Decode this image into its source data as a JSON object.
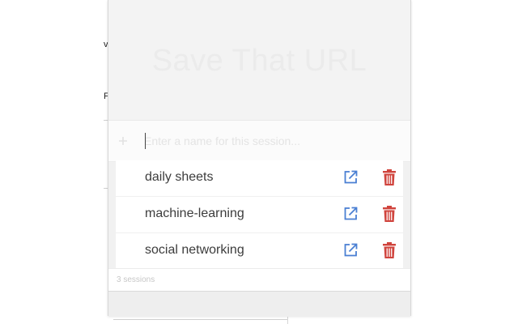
{
  "background": {
    "fragment_top": "v",
    "fragment_mid": "F"
  },
  "app": {
    "title": "Save That URL"
  },
  "input": {
    "value": "",
    "placeholder": "Enter a name for this session..."
  },
  "sessions": [
    {
      "name": "daily sheets"
    },
    {
      "name": "machine-learning"
    },
    {
      "name": "social networking"
    }
  ],
  "footer": {
    "count_text": "3 sessions"
  },
  "colors": {
    "open_icon": "#4a7fd3",
    "delete_icon": "#d0443d"
  },
  "icons": {
    "input": "plus-icon",
    "open": "external-link-icon",
    "delete": "trash-icon"
  }
}
